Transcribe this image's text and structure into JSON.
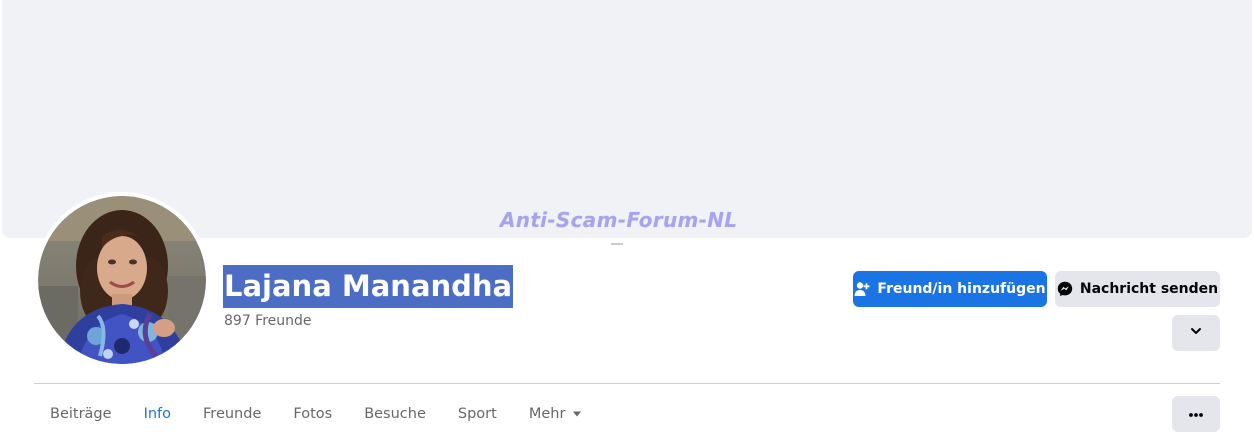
{
  "cover": {
    "watermark": "Anti-Scam-Forum-NL"
  },
  "profile": {
    "name": "Lajana Manandha",
    "friends_count": "897 Freunde",
    "avatar_icon": "profile-photo"
  },
  "actions": {
    "add_friend_label": "Freund/in hinzufügen",
    "add_friend_icon": "person-add-icon",
    "message_label": "Nachricht senden",
    "message_icon": "messenger-icon",
    "expand_icon": "chevron-down-icon",
    "more_icon": "more-dots-icon"
  },
  "tabs": [
    {
      "label": "Beiträge"
    },
    {
      "label": "Info",
      "active": true
    },
    {
      "label": "Freunde"
    },
    {
      "label": "Fotos"
    },
    {
      "label": "Besuche"
    },
    {
      "label": "Sport"
    },
    {
      "label": "Mehr",
      "has_caret": true
    }
  ],
  "colors": {
    "primary": "#1b74e4",
    "secondary_button": "#e4e6eb",
    "cover": "#f0f2f5",
    "name_highlight": "#4c6dc4",
    "muted_text": "#65676b"
  }
}
